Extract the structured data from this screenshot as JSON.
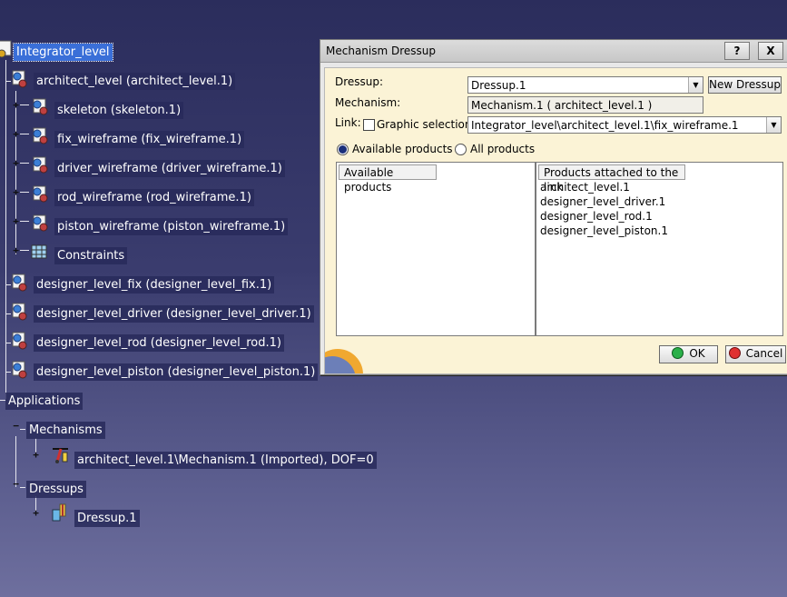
{
  "tree": {
    "root": "Integrator_level",
    "architect": "architect_level (architect_level.1)",
    "arch_children": [
      "skeleton (skeleton.1)",
      "fix_wireframe (fix_wireframe.1)",
      "driver_wireframe (driver_wireframe.1)",
      "rod_wireframe (rod_wireframe.1)",
      "piston_wireframe (piston_wireframe.1)",
      "Constraints"
    ],
    "designers": [
      "designer_level_fix (designer_level_fix.1)",
      "designer_level_driver (designer_level_driver.1)",
      "designer_level_rod (designer_level_rod.1)",
      "designer_level_piston (designer_level_piston.1)"
    ],
    "applications": "Applications",
    "mechanisms": "Mechanisms",
    "mechanism_item": "architect_level.1\\Mechanism.1 (Imported), DOF=0",
    "dressups": "Dressups",
    "dressup_item": "Dressup.1"
  },
  "dialog": {
    "title": "Mechanism Dressup",
    "help": "?",
    "close": "X",
    "dressup_label": "Dressup:",
    "dressup_value": "Dressup.1",
    "new_dressup": "New Dressup",
    "mechanism_label": "Mechanism:",
    "mechanism_value": "Mechanism.1 ( architect_level.1 )",
    "link_label": "Link:",
    "graphic_selection": "Graphic selection",
    "link_value": "Integrator_level\\architect_level.1\\fix_wireframe.1",
    "radio_available": "Available products",
    "radio_all": "All products",
    "col_available": "Available products",
    "col_attached": "Products attached to the link",
    "attached": [
      "architect_level.1",
      "designer_level_driver.1",
      "designer_level_rod.1",
      "designer_level_piston.1"
    ],
    "ok": "OK",
    "cancel": "Cancel"
  }
}
